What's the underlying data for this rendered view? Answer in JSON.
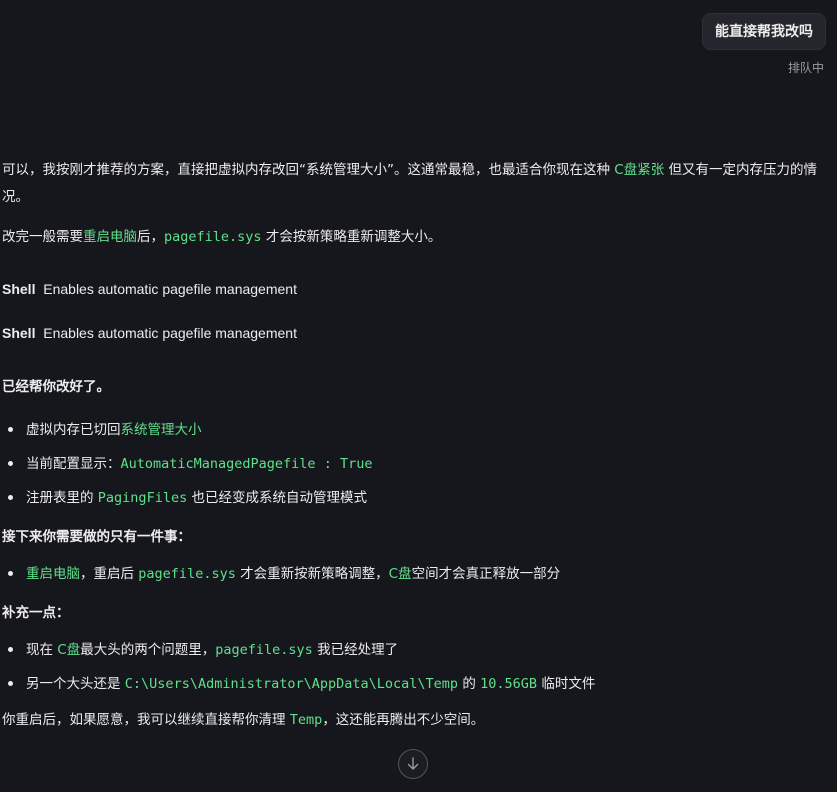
{
  "user_message": {
    "text": "能直接帮我改吗",
    "status": "排队中"
  },
  "reply": {
    "intro_pre": "可以，我按刚才推荐的方案，直接把虚拟内存改回“系统管理大小”。这通常最稳，也最适合你现在这种 ",
    "intro_hl": "C盘紧张",
    "intro_post": " 但又有一定内存压力的情况。",
    "reboot_pre": "改完一般需要",
    "reboot_hl": "重启电脑",
    "reboot_mid": "后，",
    "reboot_code": "pagefile.sys",
    "reboot_post": " 才会按新策略重新调整大小。",
    "shell_lines": [
      {
        "label": "Shell",
        "text": "Enables automatic pagefile management"
      },
      {
        "label": "Shell",
        "text": "Enables automatic pagefile management"
      }
    ],
    "done": "已经帮你改好了。",
    "bullets1": {
      "b1_pre": "虚拟内存已切回",
      "b1_hl": "系统管理大小",
      "b2_pre": "当前配置显示：",
      "b2_code": "AutomaticManagedPagefile : True",
      "b3_pre": "注册表里的 ",
      "b3_code": "PagingFiles",
      "b3_post": " 也已经变成系统自动管理模式"
    },
    "heading_next": "接下来你需要做的只有一件事：",
    "bullets2": {
      "b1_hl": "重启电脑",
      "b1_mid": "，重启后 ",
      "b1_code": "pagefile.sys",
      "b1_mid2": " 才会重新按新策略调整，",
      "b1_hl2": "C盘",
      "b1_post": "空间才会真正释放一部分"
    },
    "heading_extra": "补充一点：",
    "bullets3": {
      "b1_pre": "现在 ",
      "b1_hl": "C盘",
      "b1_mid": "最大头的两个问题里，",
      "b1_code": "pagefile.sys",
      "b1_post": " 我已经处理了",
      "b2_pre": "另一个大头还是 ",
      "b2_code": "C:\\Users\\Administrator\\AppData\\Local\\Temp",
      "b2_mid": " 的 ",
      "b2_code2": "10.56GB",
      "b2_post": " 临时文件"
    },
    "final_pre": "你重启后，如果愿意，我可以继续直接帮你清理 ",
    "final_code": "Temp",
    "final_post": "，这还能再腾出不少空间。"
  },
  "scroll_button_icon": "arrow-down-icon",
  "colors": {
    "background": "#16171d",
    "text": "#ececec",
    "accent_green": "#5fe08a",
    "bubble_bg": "#25262d",
    "muted": "#9a9ba3"
  }
}
